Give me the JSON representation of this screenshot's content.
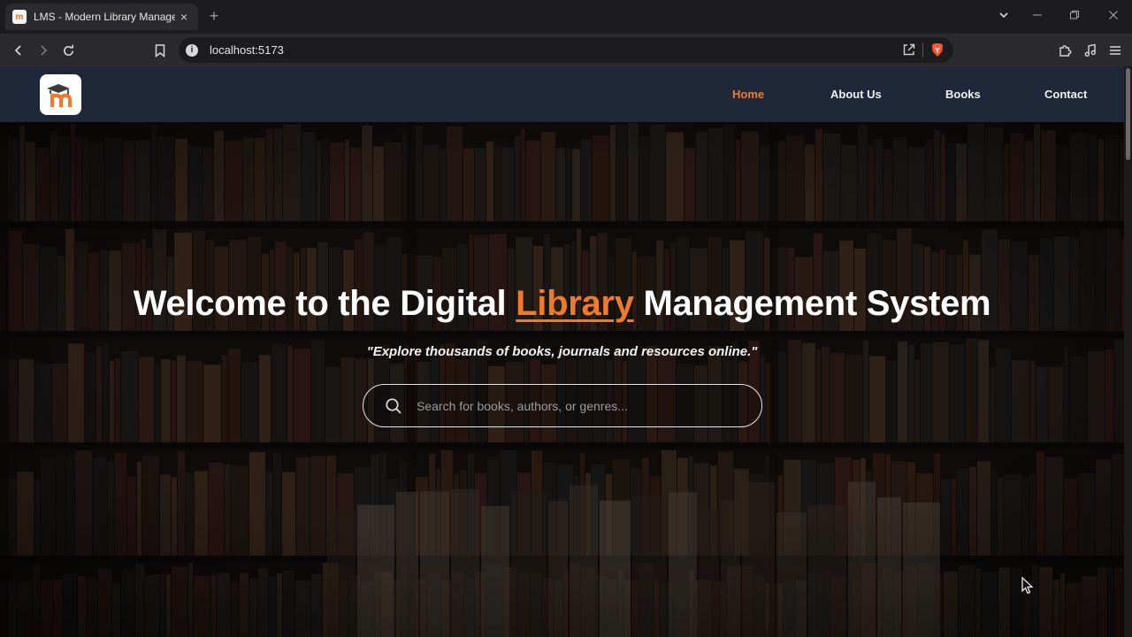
{
  "browser": {
    "tab": {
      "favicon_letter": "m",
      "title": "LMS - Modern Library Management",
      "close_glyph": "×"
    },
    "new_tab_glyph": "+",
    "url": "localhost:5173",
    "info_glyph": "i",
    "window_controls": {
      "dropdown": "⌄",
      "minimize": "–",
      "restore": "❐",
      "close": "✕"
    }
  },
  "site": {
    "logo_letter": "m",
    "nav": [
      {
        "label": "Home",
        "active": true
      },
      {
        "label": "About Us",
        "active": false
      },
      {
        "label": "Books",
        "active": false
      },
      {
        "label": "Contact",
        "active": false
      }
    ],
    "hero": {
      "title_prefix": "Welcome to the Digital ",
      "title_accent": "Library",
      "title_suffix": " Management System",
      "subtitle": "\"Explore thousands of books, journals and resources online.\"",
      "search_placeholder": "Search for books, authors, or genres..."
    }
  },
  "colors": {
    "accent": "#f07a2c",
    "navbar_bg": "#1e2838",
    "browser_bg": "#2b2b2f",
    "brave_lion": "#fb542b"
  }
}
